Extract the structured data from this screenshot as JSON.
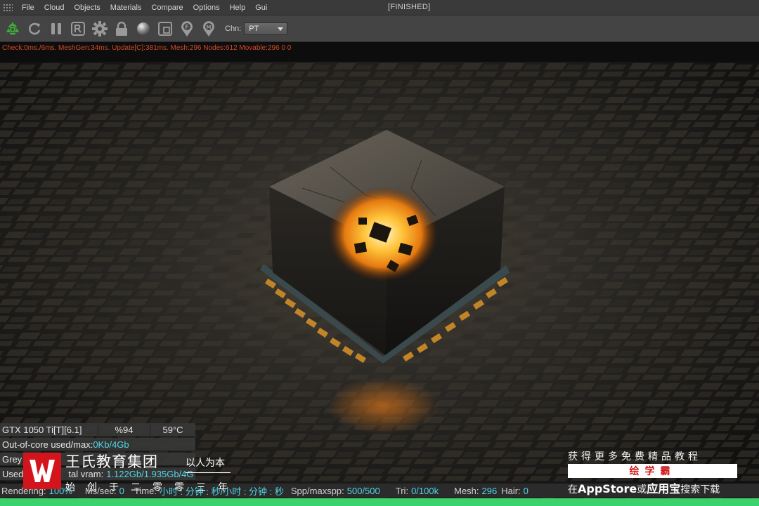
{
  "menu": {
    "items": [
      "File",
      "Cloud",
      "Objects",
      "Materials",
      "Compare",
      "Options",
      "Help",
      "Gui"
    ],
    "status": "[FINISHED]"
  },
  "toolbar": {
    "icons": [
      "recycle-icon",
      "refresh-icon",
      "pause-icon",
      "render-region-icon",
      "settings-gear-icon",
      "lock-icon",
      "material-ball-icon",
      "frame-icon",
      "focus-pick-icon",
      "material-pick-icon"
    ],
    "chn_label": "Chn:",
    "chn_value": "PT",
    "accent": "#3fae35"
  },
  "info": {
    "text": "Check:0ms./6ms. MeshGen:34ms. Update[C]:381ms. Mesh:296 Nodes:612 Movable:296  0 0",
    "color": "#d24a28"
  },
  "stats": {
    "gpu_name": "GTX 1050 Ti[T][6.1]",
    "gpu_load": "%94",
    "gpu_temp": "59°C",
    "ooc_label": "Out-of-core used/max:",
    "ooc_value": "0Kb/4Gb",
    "grey_label": "Grey",
    "used_label": "Used",
    "vram_label": "tal vram:",
    "vram_value": "1.122Gb/1.935Gb/4G"
  },
  "statusbar": {
    "rendering_label": "Rendering:",
    "rendering_value": "100%",
    "mssec_label": "Ms/sec:",
    "mssec_value": "0",
    "time_label": "Time:",
    "time_value": "小时 : 分钟 : 秒/小时 : 分钟 : 秒",
    "spp_label": "Spp/maxspp:",
    "spp_value": "500/500",
    "tri_label": "Tri:",
    "tri_value": "0/100k",
    "mesh_label": "Mesh:",
    "mesh_value": "296",
    "hair_label": "Hair:",
    "hair_value": "0",
    "progress": 1.0,
    "progress_color": "#3dd16b"
  },
  "watermark": {
    "name": "王氏教育集团",
    "slogan": "以人为本",
    "sub": "始创于二零零三年",
    "logo_color": "#d4141d"
  },
  "promo": {
    "line1": "获得更多免费精品教程",
    "box": "绘学霸",
    "line3_prefix": "在",
    "line3_store": "AppStore",
    "line3_mid": "或",
    "line3_app": "应用宝",
    "line3_suffix": "搜索下载"
  }
}
